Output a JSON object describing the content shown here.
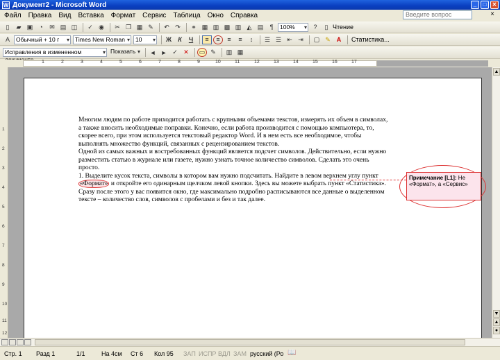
{
  "window": {
    "title": "Документ2 - Microsoft Word"
  },
  "menu": {
    "items": [
      "Файл",
      "Правка",
      "Вид",
      "Вставка",
      "Формат",
      "Сервис",
      "Таблица",
      "Окно",
      "Справка"
    ],
    "help_placeholder": "Введите вопрос",
    "close_doc": "×"
  },
  "toolbar": {
    "zoom": "100%",
    "reading_label": "Чтение",
    "style": "Обычный + 10 г",
    "font": "Times New Roman",
    "size": "10",
    "bold": "Ж",
    "italic": "К",
    "underline": "Ч",
    "statistics_label": "Статистика..."
  },
  "review_toolbar": {
    "mode": "Исправления в измененном документе",
    "show_label": "Показать"
  },
  "ruler": {
    "h_numbers": [
      "1",
      "2",
      "3",
      "4",
      "5",
      "6",
      "7",
      "8",
      "9",
      "10",
      "11",
      "12",
      "13",
      "14",
      "15",
      "16",
      "17"
    ],
    "v_numbers": [
      "1",
      "2",
      "3",
      "4",
      "5",
      "6",
      "7",
      "8",
      "9",
      "10",
      "11",
      "12"
    ]
  },
  "document": {
    "paragraph1": "Многим людям по работе приходится работать с крупными объемами текстов, измерять их объем в символах, а также вносить необходимые поправки. Конечно, если работа производится с помощью компьютера, то, скорее всего, при этом используется текстовый редактор Word. И в нем есть все необходимое, чтобы выполнять множество функций, связанных с рецензированием текстов.",
    "paragraph2": "Одной из самых важных и востребованных функций является подсчет символов. Действительно, если нужно разместить статью в журнале или газете, нужно узнать точное количество символов. Сделать это очень просто.",
    "list_item1_a": "1. Выделите кусок текста, символы в котором вам нужно подсчитать. Найдите в левом верхнем углу пункт ",
    "list_item1_mark": "«Формат»",
    "list_item1_b": " и откройте его одинарным щелчком левой кнопки. Здесь вы можете выбрать пункт «Статистика». Сразу после этого у вас появится окно, где максимально подробно расписываются все данные о выделенном тексте – количество слов, символов с пробелами и без и так далее."
  },
  "comment": {
    "label": "Примечание [L1]:",
    "text": " Не «Формат», а «Сервис»"
  },
  "status_bar": {
    "page": "Стр. 1",
    "section": "Разд 1",
    "pages": "1/1",
    "position": "На 4см",
    "line": "Ст 6",
    "column": "Кол 95",
    "rec": "ЗАП",
    "trk": "ИСПР",
    "ext": "ВДЛ",
    "ovr": "ЗАМ",
    "language": "русский (Ро"
  }
}
